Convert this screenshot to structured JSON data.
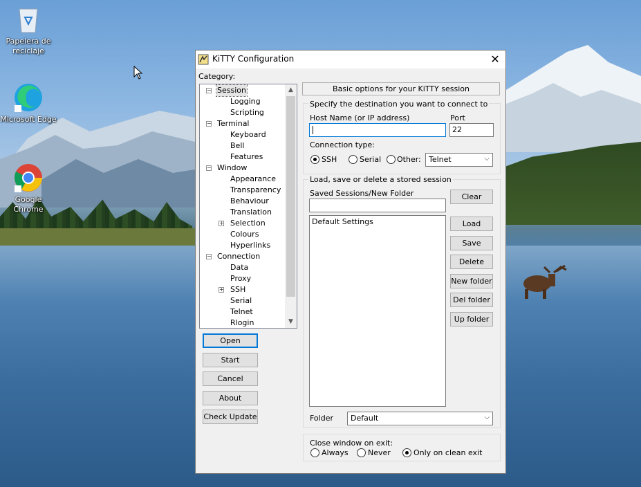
{
  "desktop": {
    "icons": [
      {
        "label": "Papelera de reciclaje"
      },
      {
        "label": "Microsoft Edge"
      },
      {
        "label": "Google Chrome"
      }
    ]
  },
  "window": {
    "title": "KiTTY Configuration",
    "close": "✕",
    "category_label": "Category:",
    "tree": [
      {
        "label": "Session",
        "expander": "−",
        "selected": true
      },
      {
        "label": "Logging"
      },
      {
        "label": "Scripting"
      },
      {
        "label": "Terminal",
        "expander": "−"
      },
      {
        "label": "Keyboard"
      },
      {
        "label": "Bell"
      },
      {
        "label": "Features"
      },
      {
        "label": "Window",
        "expander": "−"
      },
      {
        "label": "Appearance"
      },
      {
        "label": "Transparency"
      },
      {
        "label": "Behaviour"
      },
      {
        "label": "Translation"
      },
      {
        "label": "Selection",
        "expander": "+"
      },
      {
        "label": "Colours"
      },
      {
        "label": "Hyperlinks"
      },
      {
        "label": "Connection",
        "expander": "−"
      },
      {
        "label": "Data"
      },
      {
        "label": "Proxy"
      },
      {
        "label": "SSH",
        "expander": "+"
      },
      {
        "label": "Serial"
      },
      {
        "label": "Telnet"
      },
      {
        "label": "Rlogin"
      }
    ],
    "left_buttons": {
      "open": "Open",
      "start": "Start",
      "cancel": "Cancel",
      "about": "About",
      "check_update": "Check Update"
    },
    "panel_header": "Basic options for your KiTTY session",
    "destination": {
      "heading": "Specify the destination you want to connect to",
      "host_label": "Host Name (or IP address)",
      "host_value": "",
      "port_label": "Port",
      "port_value": "22",
      "conn_type_label": "Connection type:",
      "radio_ssh": "SSH",
      "radio_serial": "Serial",
      "radio_other": "Other:",
      "other_select": "Telnet"
    },
    "sessions": {
      "heading": "Load, save or delete a stored session",
      "saved_label": "Saved Sessions/New Folder",
      "saved_value": "",
      "list": [
        "Default Settings"
      ],
      "buttons": {
        "clear": "Clear",
        "load": "Load",
        "save": "Save",
        "delete": "Delete",
        "new_folder": "New folder",
        "del_folder": "Del folder",
        "up_folder": "Up folder"
      },
      "folder_label": "Folder",
      "folder_value": "Default"
    },
    "close_on_exit": {
      "label": "Close window on exit:",
      "always": "Always",
      "never": "Never",
      "clean": "Only on clean exit"
    }
  },
  "colors": {
    "focus": "#0078d7",
    "button_face": "#e1e1e1",
    "window_bg": "#f0f0f0"
  }
}
